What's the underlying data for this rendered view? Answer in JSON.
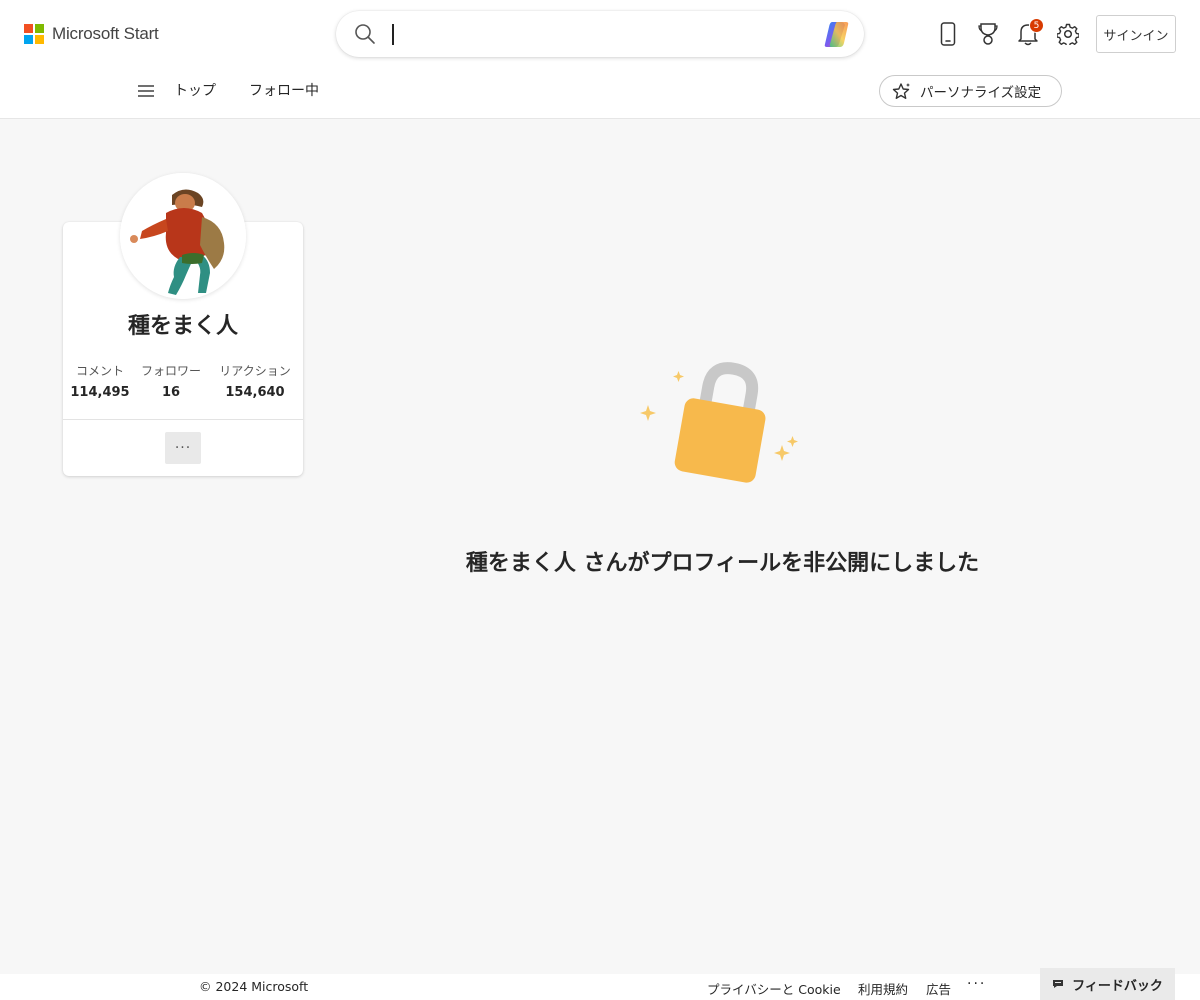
{
  "header": {
    "logo_text": "Microsoft Start",
    "search_placeholder": "",
    "notification_count": "5",
    "signin_label": "サインイン",
    "colors": {
      "ms_red": "#f25022",
      "ms_green": "#7fba00",
      "ms_blue": "#00a4ef",
      "ms_yellow": "#ffb900",
      "badge": "#d83b01"
    }
  },
  "nav": {
    "top_label": "トップ",
    "following_label": "フォロー中",
    "personalize_label": "パーソナライズ設定"
  },
  "profile": {
    "name": "種をまく人",
    "stats": [
      {
        "label": "コメント",
        "value": "114,495"
      },
      {
        "label": "フォロワー",
        "value": "16"
      },
      {
        "label": "リアクション",
        "value": "154,640"
      }
    ],
    "more_label": "···"
  },
  "main": {
    "private_message": "種をまく人 さんがプロフィールを非公開にしました",
    "lock_color": "#f7b94c"
  },
  "footer": {
    "copyright": "© 2024 Microsoft",
    "privacy": "プライバシーと Cookie",
    "terms": "利用規約",
    "ads": "広告",
    "more": "···",
    "feedback_label": "フィードバック"
  }
}
